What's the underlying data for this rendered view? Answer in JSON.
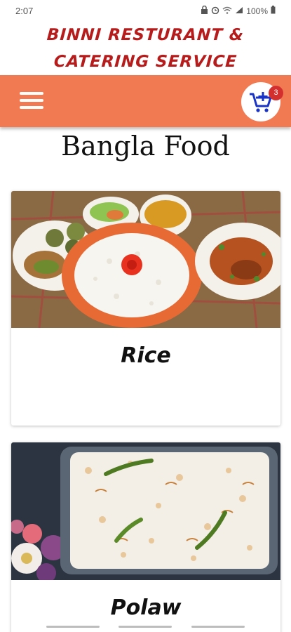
{
  "status": {
    "time": "2:07",
    "battery": "100%",
    "icons": [
      "lock-icon",
      "alarm-icon",
      "wifi-icon",
      "signal-icon",
      "battery-icon"
    ]
  },
  "brand": {
    "line1": "BINNI RESTURANT &",
    "line2": "CATERING SERVICE",
    "color": "#b71c1c"
  },
  "toolbar": {
    "color": "#f27a52",
    "menu_icon": "hamburger-menu-icon",
    "cart_icon": "add-to-cart-icon",
    "cart_count": "3"
  },
  "category": {
    "title": "Bangla Food"
  },
  "items": [
    {
      "label": "Rice"
    },
    {
      "label": "Polaw"
    }
  ]
}
